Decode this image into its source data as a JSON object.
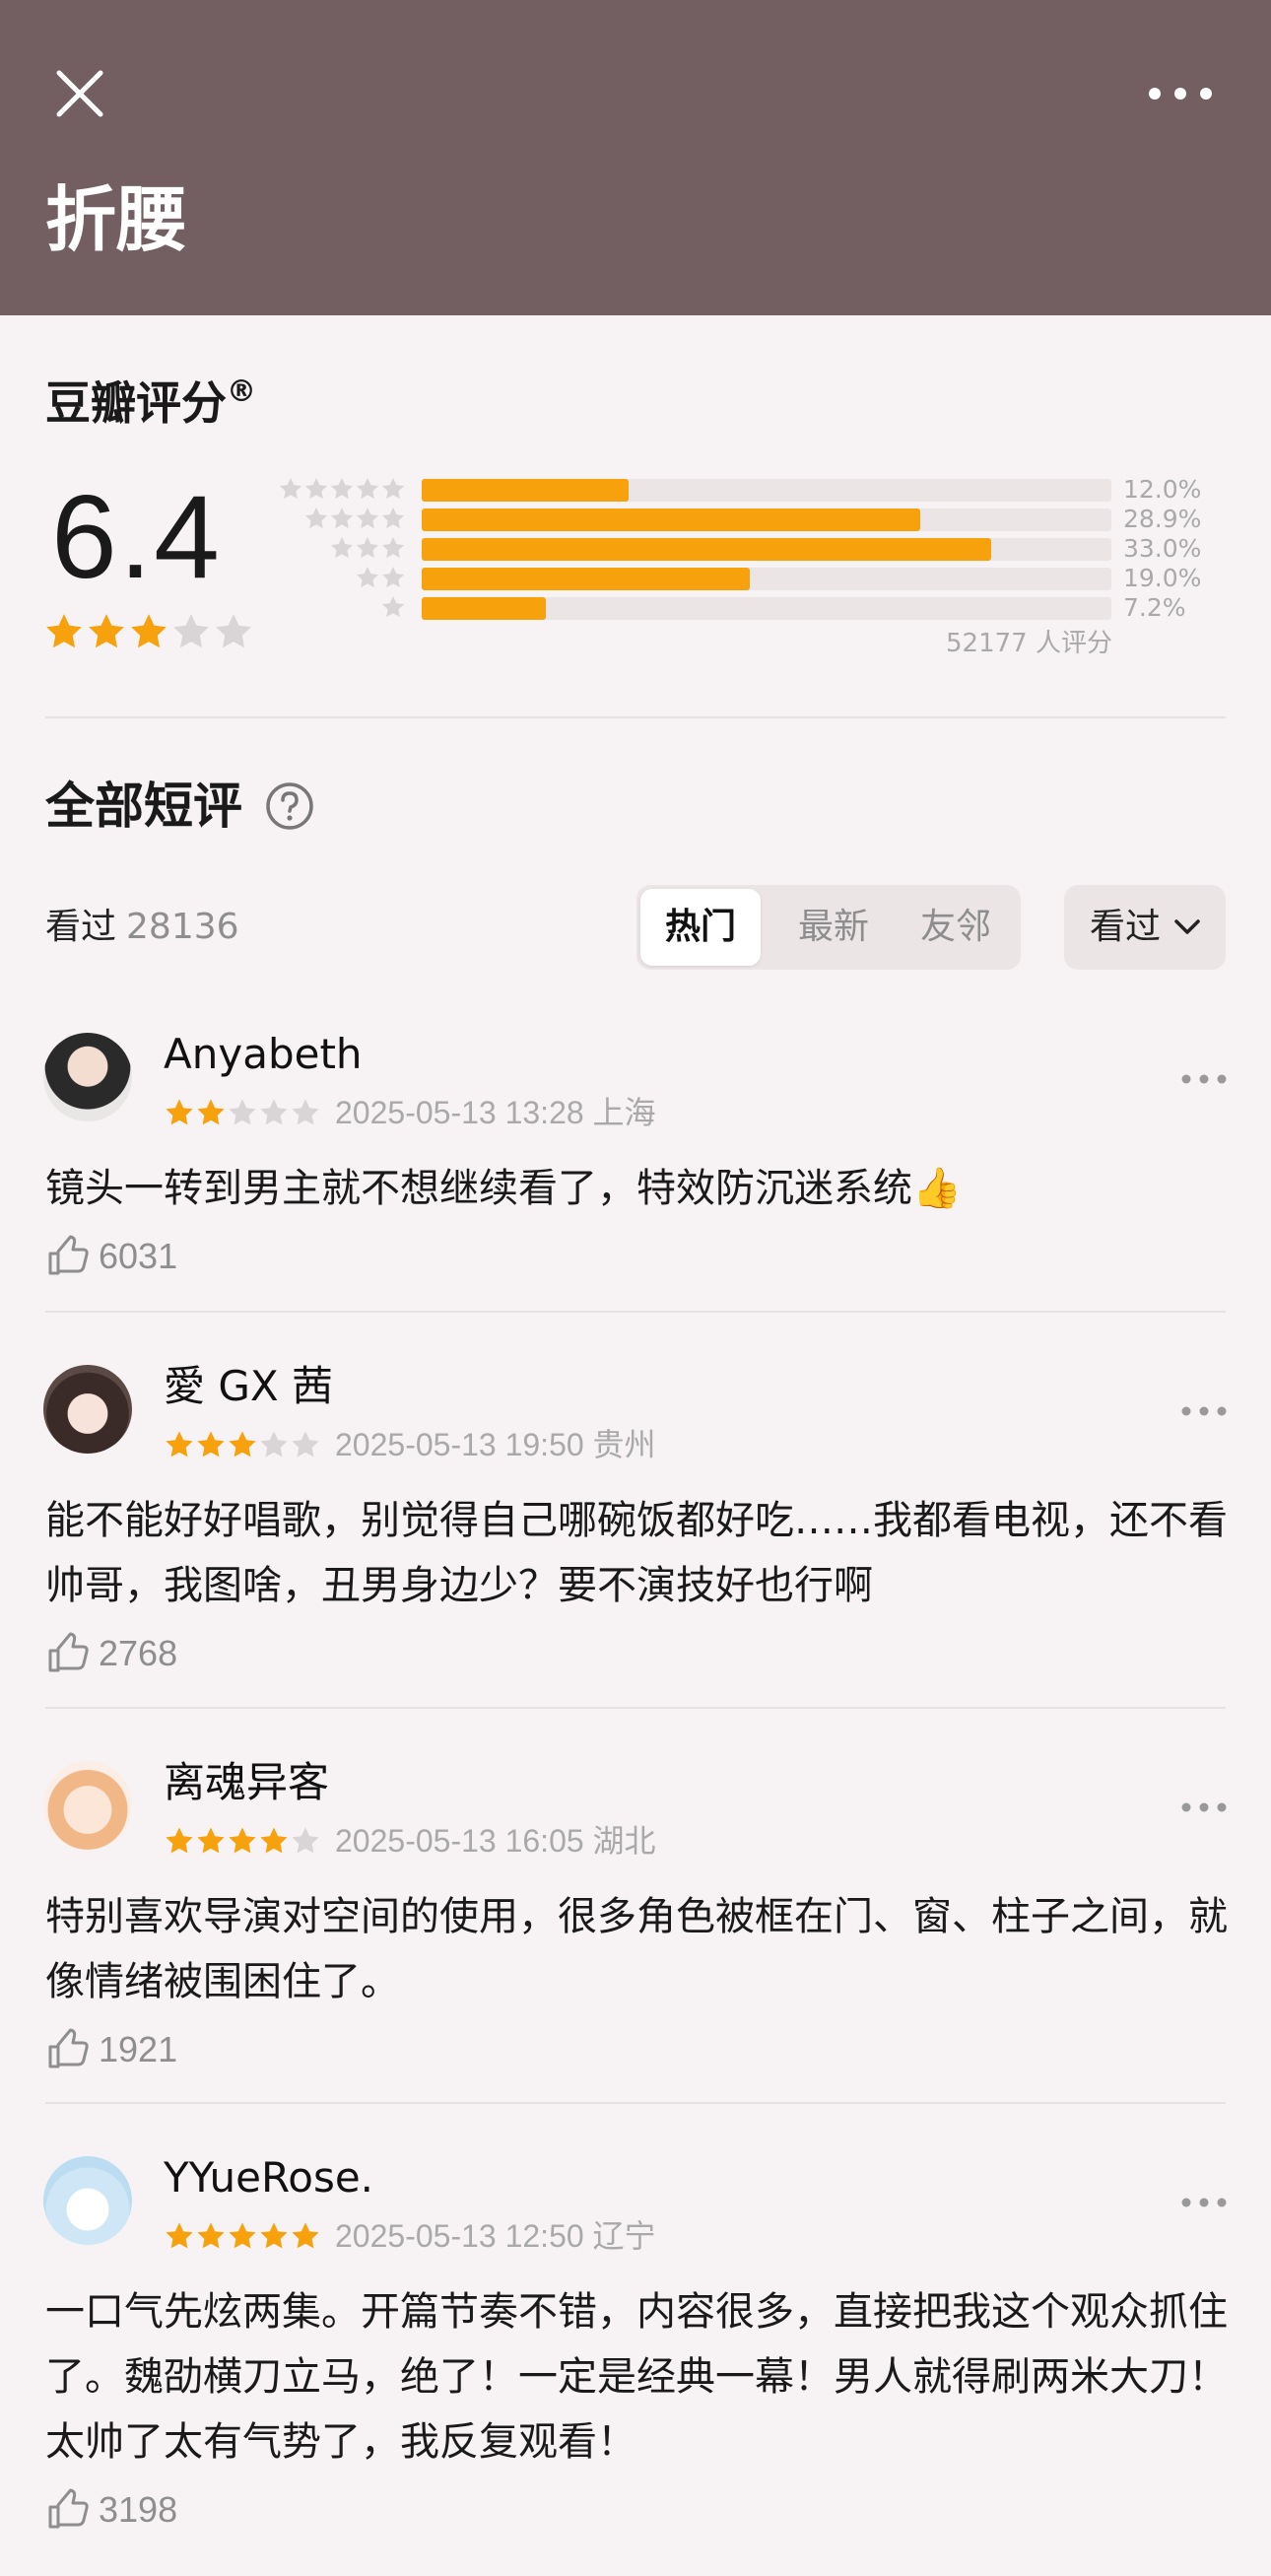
{
  "header": {
    "title": "折腰",
    "close_icon": "close-icon",
    "more_icon": "more-horizontal-icon",
    "bg_color": "#735f61"
  },
  "rating": {
    "label": "豆瓣评分",
    "registered_mark": "®",
    "score": "6.4",
    "stars_out_of_5": 3,
    "distribution": [
      {
        "stars": 5,
        "percent": 12.0,
        "label": "12.0%"
      },
      {
        "stars": 4,
        "percent": 28.9,
        "label": "28.9%"
      },
      {
        "stars": 3,
        "percent": 33.0,
        "label": "33.0%"
      },
      {
        "stars": 2,
        "percent": 19.0,
        "label": "19.0%"
      },
      {
        "stars": 1,
        "percent": 7.2,
        "label": "7.2%"
      }
    ],
    "count_text": "52177 人评分",
    "bar_color": "#f7a10d"
  },
  "short_reviews": {
    "title": "全部短评",
    "help_icon": "question-circle-icon",
    "watched_label": "看过",
    "watched_count": "28136",
    "tabs": [
      "热门",
      "最新",
      "友邻"
    ],
    "active_tab": "热门",
    "filter_label": "看过",
    "filter_icon": "chevron-down-icon"
  },
  "comments": [
    {
      "name": "Anyabeth",
      "stars": 2,
      "time": "2025-05-13 13:28 上海",
      "text": "镜头一转到男主就不想继续看了，特效防沉迷系统👍",
      "likes": "6031"
    },
    {
      "name": "愛 GX 茜",
      "stars": 3,
      "time": "2025-05-13 19:50 贵州",
      "text": "能不能好好唱歌，别觉得自己哪碗饭都好吃……我都看电视，还不看帅哥，我图啥，丑男身边少？要不演技好也行啊",
      "likes": "2768"
    },
    {
      "name": "离魂异客",
      "stars": 4,
      "time": "2025-05-13 16:05 湖北",
      "text": "特别喜欢导演对空间的使用，很多角色被框在门、窗、柱子之间，就像情绪被围困住了。",
      "likes": "1921"
    },
    {
      "name": "YYueRose.",
      "stars": 5,
      "time": "2025-05-13 12:50 辽宁",
      "text": "一口气先炫两集。开篇节奏不错，内容很多，直接把我这个观众抓住了。魏劭横刀立马，绝了！一定是经典一幕！男人就得刷两米大刀！太帅了太有气势了，我反复观看！",
      "likes": "3198"
    }
  ]
}
